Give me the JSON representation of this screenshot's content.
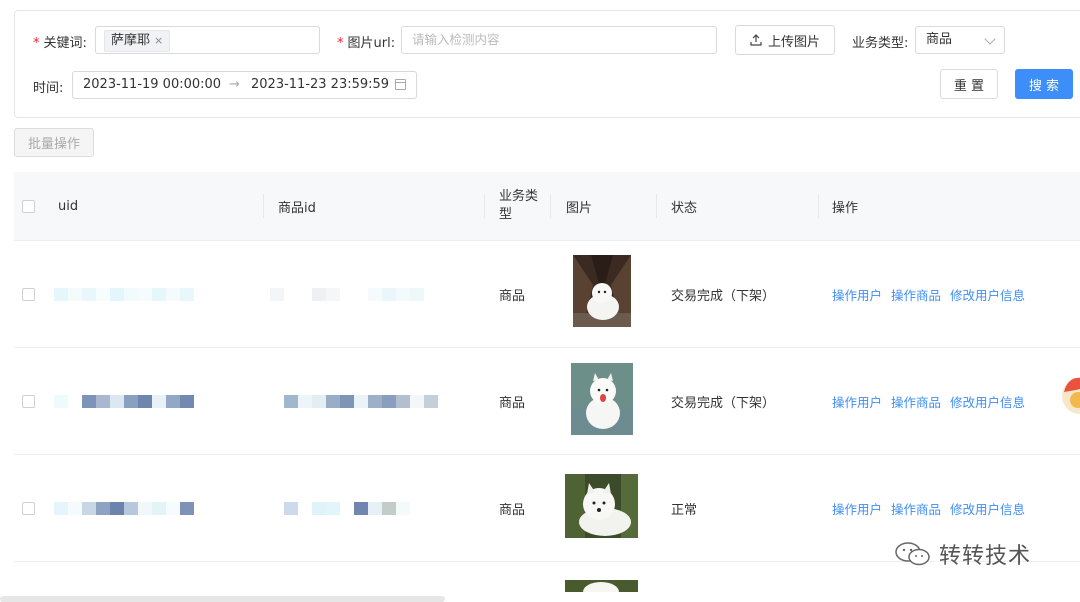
{
  "filters": {
    "keyword_label": "关键词:",
    "keyword_tag": "萨摩耶",
    "keyword_tag_close": "×",
    "image_url_label": "图片url:",
    "image_url_placeholder": "请输入检测内容",
    "upload_button": "上传图片",
    "business_type_label": "业务类型:",
    "business_type_value": "商品",
    "time_label": "时间:",
    "time_start": "2023-11-19 00:00:00",
    "time_arrow": "→",
    "time_end": "2023-11-23 23:59:59",
    "reset_button": "重 置",
    "search_button": "搜 索"
  },
  "batch_button": "批量操作",
  "table": {
    "columns": [
      "uid",
      "商品id",
      "业务类型",
      "图片",
      "状态",
      "操作"
    ],
    "rows": [
      {
        "business_type": "商品",
        "status": "交易完成（下架）",
        "ops": [
          "操作用户",
          "操作商品",
          "修改用户信息"
        ]
      },
      {
        "business_type": "商品",
        "status": "交易完成（下架）",
        "ops": [
          "操作用户",
          "操作商品",
          "修改用户信息"
        ]
      },
      {
        "business_type": "商品",
        "status": "正常",
        "ops": [
          "操作用户",
          "操作商品",
          "修改用户信息"
        ]
      }
    ]
  },
  "watermark": "转转技术",
  "colors": {
    "primary": "#3d8ef8",
    "required": "#f5222d",
    "link": "#3d8ef8"
  }
}
